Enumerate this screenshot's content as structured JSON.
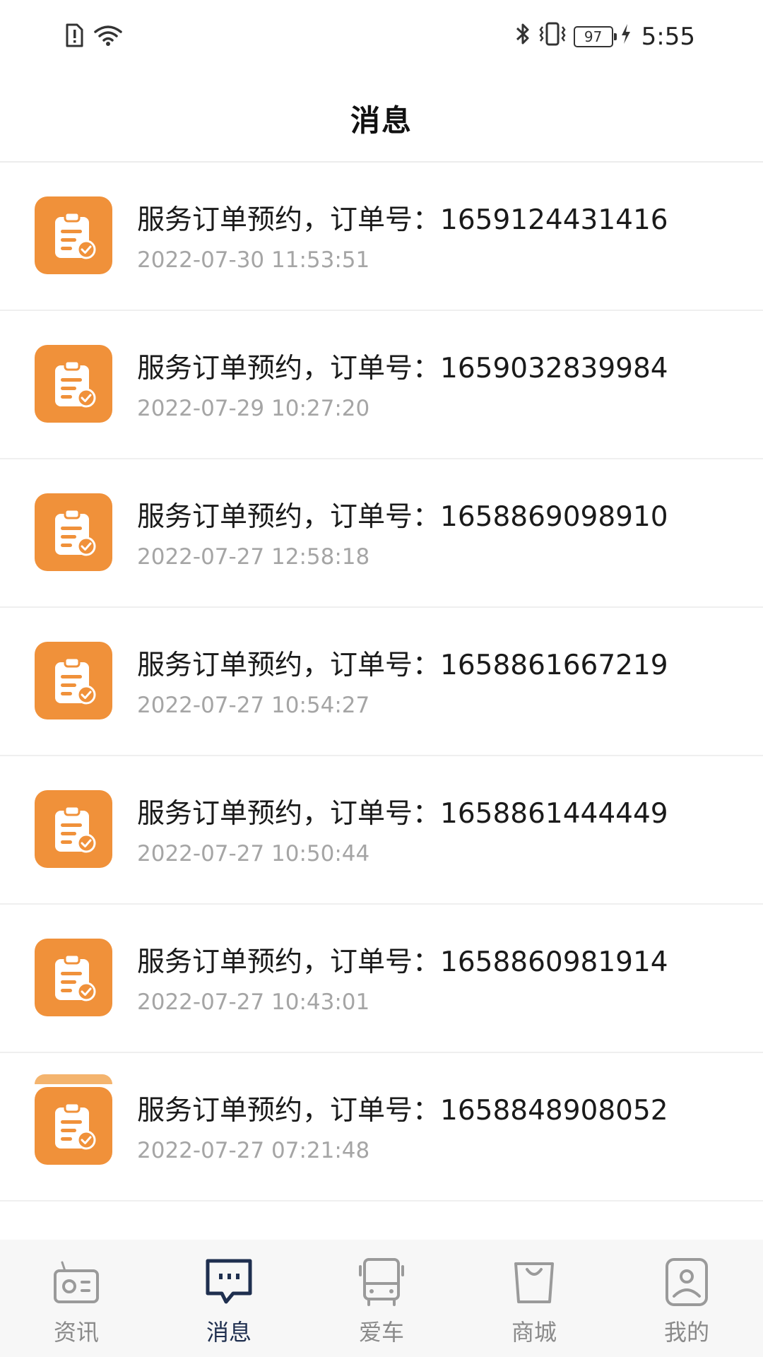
{
  "status_bar": {
    "battery": "97",
    "time": "5:55"
  },
  "header": {
    "title": "消息"
  },
  "messages": [
    {
      "title": "服务订单预约，订单号：1659124431416",
      "time": "2022-07-30 11:53:51"
    },
    {
      "title": "服务订单预约，订单号：1659032839984",
      "time": "2022-07-29 10:27:20"
    },
    {
      "title": "服务订单预约，订单号：1658869098910",
      "time": "2022-07-27 12:58:18"
    },
    {
      "title": "服务订单预约，订单号：1658861667219",
      "time": "2022-07-27 10:54:27"
    },
    {
      "title": "服务订单预约，订单号：1658861444449",
      "time": "2022-07-27 10:50:44"
    },
    {
      "title": "服务订单预约，订单号：1658860981914",
      "time": "2022-07-27 10:43:01"
    },
    {
      "title": "服务订单预约，订单号：1658848908052",
      "time": "2022-07-27 07:21:48"
    }
  ],
  "bottom_nav": {
    "items": [
      {
        "label": "资讯",
        "icon": "radio-icon",
        "active": false
      },
      {
        "label": "消息",
        "icon": "chat-icon",
        "active": true
      },
      {
        "label": "爱车",
        "icon": "bus-icon",
        "active": false
      },
      {
        "label": "商城",
        "icon": "shopping-bag-icon",
        "active": false
      },
      {
        "label": "我的",
        "icon": "profile-icon",
        "active": false
      }
    ]
  },
  "colors": {
    "accent": "#f0913a",
    "active_nav": "#1f2f4f",
    "inactive_nav": "#8a8a8a"
  }
}
